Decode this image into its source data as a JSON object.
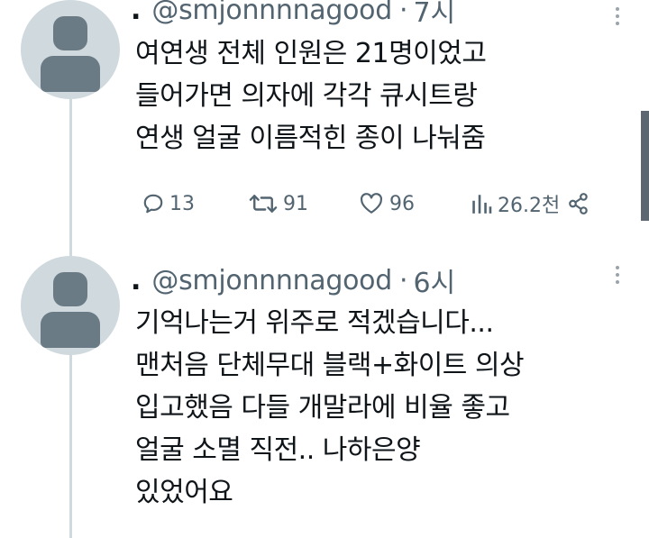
{
  "tweets": [
    {
      "lead": ".",
      "handle": "@smjonnnnagood",
      "separator": "·",
      "time": "7시",
      "text": "여연생 전체 인원은 21명이었고\n들어가면 의자에 각각 큐시트랑\n연생 얼굴 이름적힌 종이 나눠줌",
      "replies": "13",
      "retweets": "91",
      "likes": "96",
      "views": "26.2천"
    },
    {
      "lead": ".",
      "handle": "@smjonnnnagood",
      "separator": "·",
      "time": "6시",
      "text": "기억나는거 위주로 적겠습니다...\n맨처음 단체무대 블랙+화이트 의상\n입고했음 다들 개말라에 비율 좋고\n얼굴 소멸 직전.. 나하은양\n있었어요"
    }
  ],
  "icons": {
    "reply": "reply-icon",
    "retweet": "retweet-icon",
    "like": "heart-icon",
    "views": "views-chart-icon",
    "share": "share-icon",
    "more": "more-dots-icon"
  },
  "colors": {
    "text": "#0f1419",
    "muted": "#536471",
    "avatar_bg": "#cfd9de",
    "avatar_fg": "#6b7b86"
  }
}
